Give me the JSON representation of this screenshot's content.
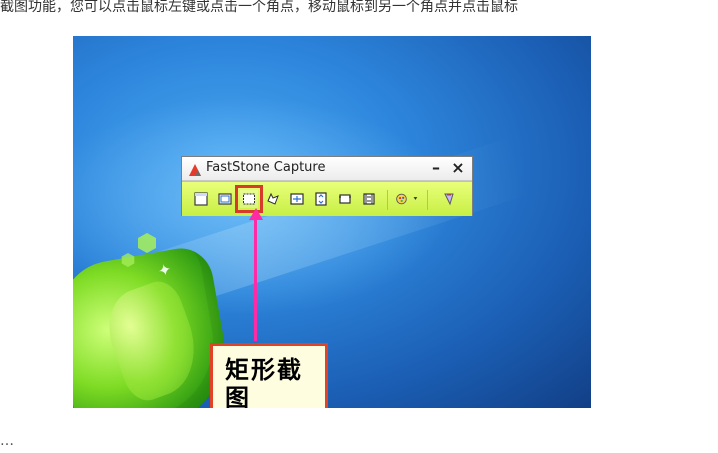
{
  "article": {
    "top_line": "截图功能，您可以点击鼠标左键或点击一个角点，移动鼠标到另一个角点并点击鼠标",
    "bottom_line": "…"
  },
  "window": {
    "title": "FastStone Capture",
    "minimize_label": "–",
    "close_label": "×"
  },
  "callout": {
    "text": "矩形截图"
  },
  "icons": {
    "logo": "faststone-logo-icon",
    "tools": [
      "capture-active-window-icon",
      "capture-window-object-icon",
      "capture-rectangular-region-icon",
      "capture-freehand-region-icon",
      "capture-full-screen-icon",
      "capture-scrolling-window-icon",
      "capture-fixed-region-icon",
      "screen-recorder-icon",
      "output-settings-dropdown-icon",
      "settings-menu-icon"
    ]
  },
  "colors": {
    "pointer": "#ff2aa6",
    "highlight": "#d73a2a",
    "toolbar": "#d7f65a"
  }
}
